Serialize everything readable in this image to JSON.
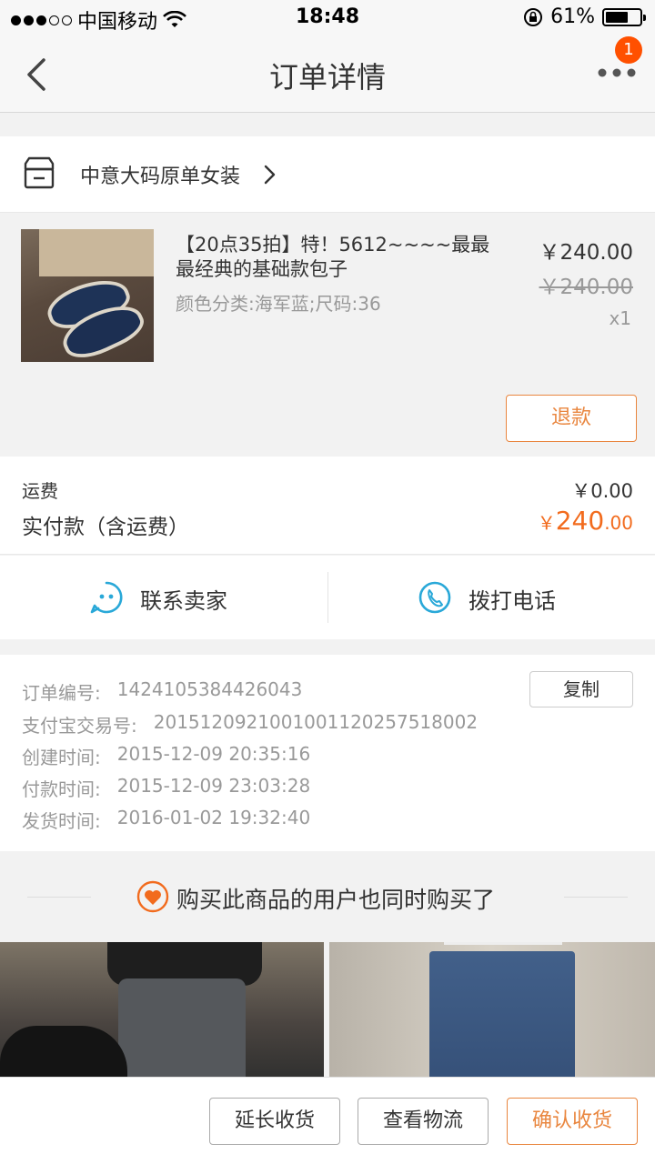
{
  "status_bar": {
    "carrier": "中国移动",
    "time": "18:48",
    "battery_percent": "61%",
    "battery_level": 0.61
  },
  "nav": {
    "title": "订单详情",
    "badge_count": "1"
  },
  "shop": {
    "name": "中意大码原单女装"
  },
  "item": {
    "title": "【20点35拍】特！5612~~~~最最最经典的基础款包子",
    "sku": "颜色分类:海军蓝;尺码:36",
    "price": "￥240.00",
    "original_price": "￥240.00",
    "quantity": "x1",
    "refund_label": "退款"
  },
  "payment": {
    "shipping_label": "运费",
    "shipping_value": "￥0.00",
    "paid_label": "实付款（含运费）",
    "paid_currency": "￥",
    "paid_integer": "240",
    "paid_decimal": ".00"
  },
  "contact": {
    "seller_label": "联系卖家",
    "phone_label": "拨打电话"
  },
  "order_info": {
    "copy_label": "复制",
    "rows": [
      {
        "label": "订单编号:",
        "value": "1424105384426043"
      },
      {
        "label": "支付宝交易号:",
        "value": "2015120921001001120257518002"
      },
      {
        "label": "创建时间:",
        "value": "2015-12-09 20:35:16"
      },
      {
        "label": "付款时间:",
        "value": "2015-12-09 23:03:28"
      },
      {
        "label": "发货时间:",
        "value": "2016-01-02 19:32:40"
      }
    ]
  },
  "recommend": {
    "text": "购买此商品的用户也同时购买了"
  },
  "bottom_actions": {
    "extend_label": "延长收货",
    "logistics_label": "查看物流",
    "confirm_label": "确认收货"
  },
  "colors": {
    "accent": "#ff5000",
    "price_orange": "#f26b1d",
    "button_orange": "#e9863f",
    "icon_blue": "#29a8d8"
  }
}
